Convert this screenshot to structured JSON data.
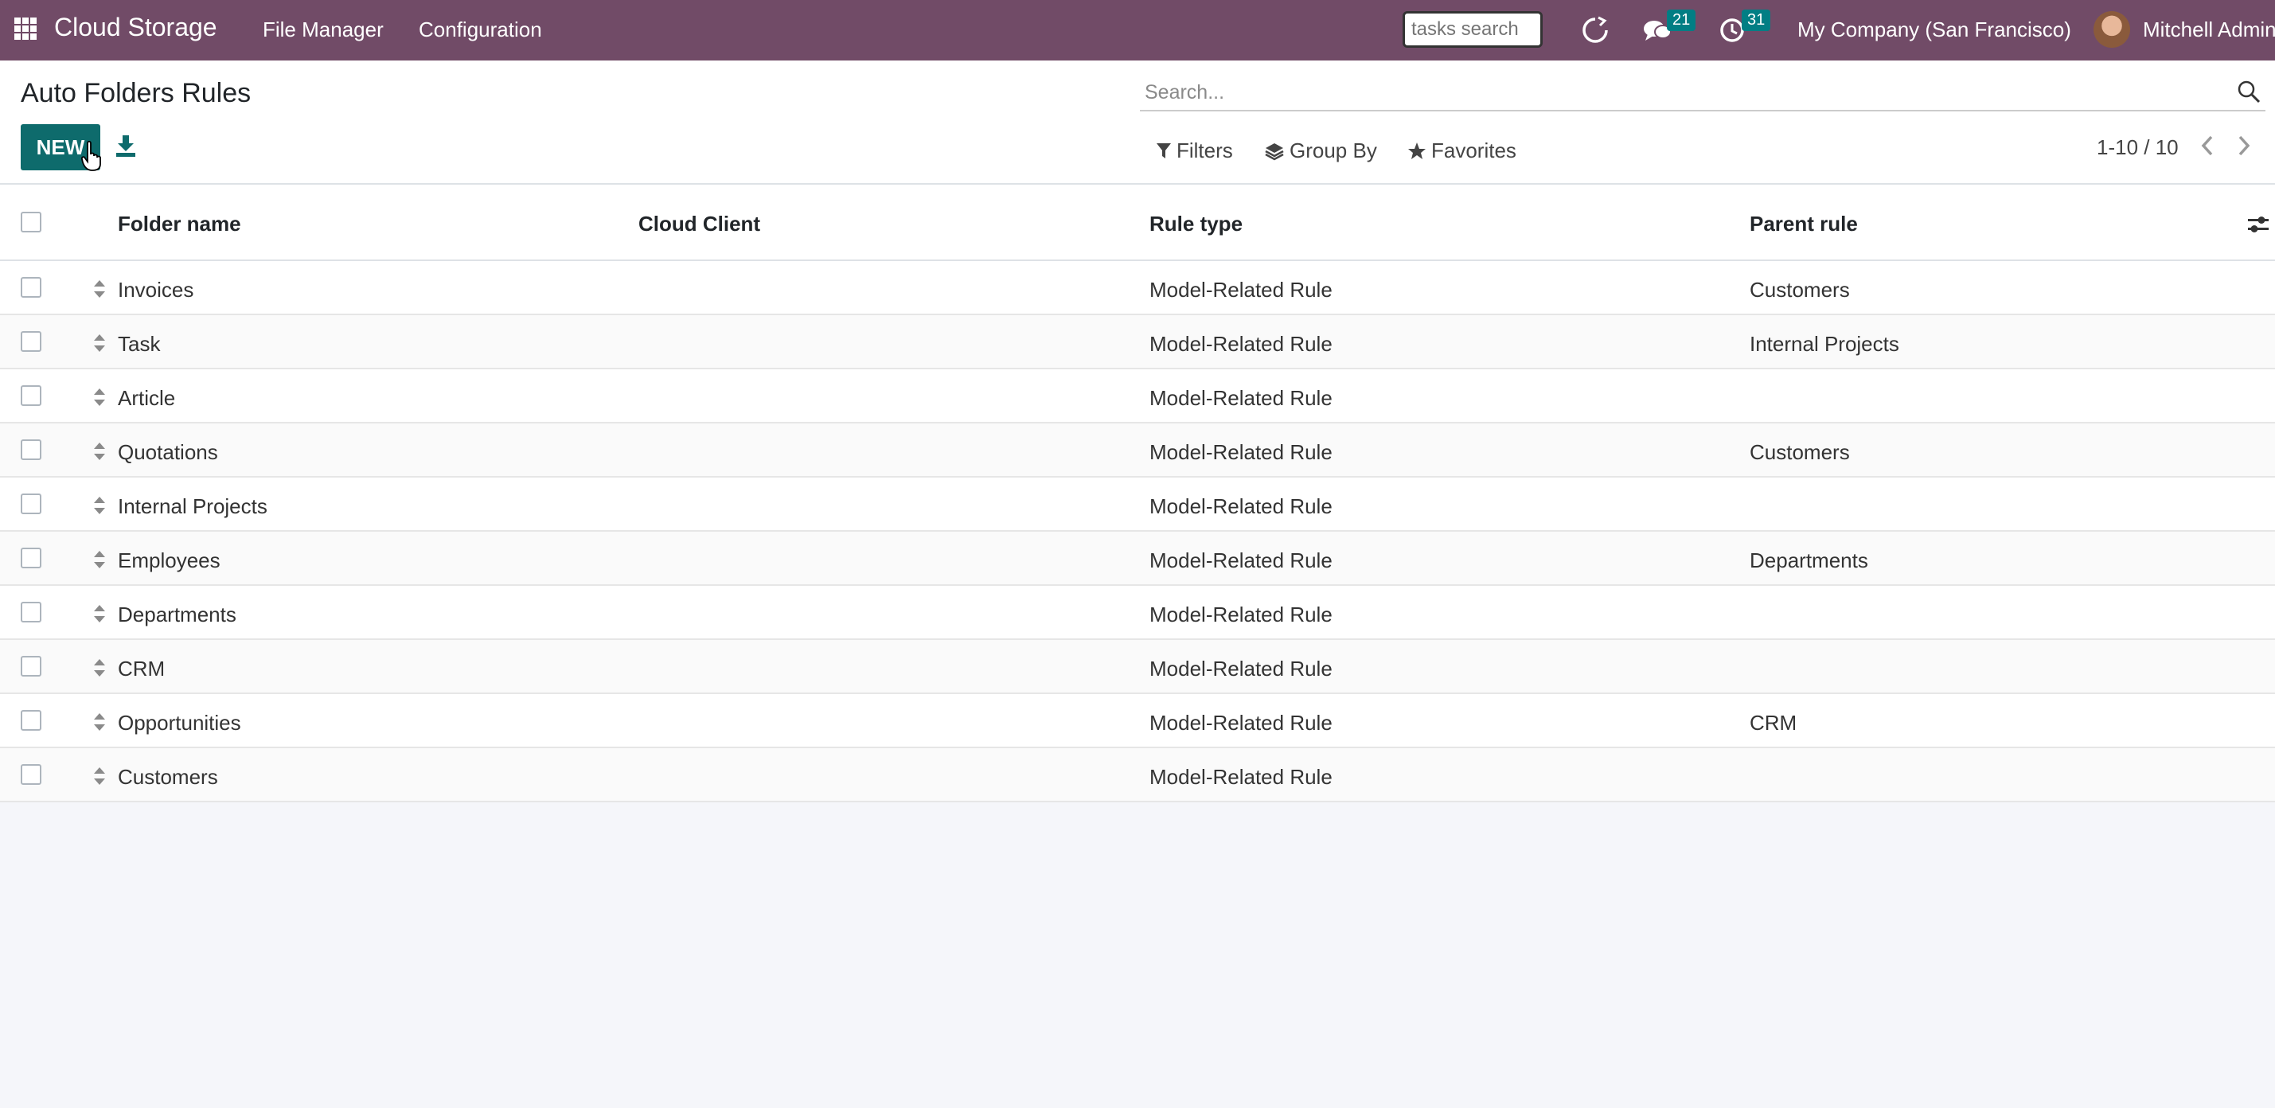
{
  "navbar": {
    "brand": "Cloud Storage",
    "menu": [
      "File Manager",
      "Configuration"
    ],
    "tasks_search_placeholder": "tasks search",
    "messages_count": "21",
    "activities_count": "31",
    "company": "My Company (San Francisco)",
    "user": "Mitchell Admin"
  },
  "control": {
    "title": "Auto Folders Rules",
    "new_label": "NEW",
    "search_placeholder": "Search...",
    "filters_label": "Filters",
    "group_by_label": "Group By",
    "favorites_label": "Favorites",
    "pager": "1-10 / 10"
  },
  "table": {
    "headers": {
      "folder_name": "Folder name",
      "cloud_client": "Cloud Client",
      "rule_type": "Rule type",
      "parent_rule": "Parent rule"
    },
    "rows": [
      {
        "folder": "Invoices",
        "client": "",
        "type": "Model-Related Rule",
        "parent": "Customers"
      },
      {
        "folder": "Task",
        "client": "",
        "type": "Model-Related Rule",
        "parent": "Internal Projects"
      },
      {
        "folder": "Article",
        "client": "",
        "type": "Model-Related Rule",
        "parent": ""
      },
      {
        "folder": "Quotations",
        "client": "",
        "type": "Model-Related Rule",
        "parent": "Customers"
      },
      {
        "folder": "Internal Projects",
        "client": "",
        "type": "Model-Related Rule",
        "parent": ""
      },
      {
        "folder": "Employees",
        "client": "",
        "type": "Model-Related Rule",
        "parent": "Departments"
      },
      {
        "folder": "Departments",
        "client": "",
        "type": "Model-Related Rule",
        "parent": ""
      },
      {
        "folder": "CRM",
        "client": "",
        "type": "Model-Related Rule",
        "parent": ""
      },
      {
        "folder": "Opportunities",
        "client": "",
        "type": "Model-Related Rule",
        "parent": "CRM"
      },
      {
        "folder": "Customers",
        "client": "",
        "type": "Model-Related Rule",
        "parent": ""
      }
    ]
  },
  "colors": {
    "navbar": "#714b67",
    "primary_button": "#0e6b6c",
    "badge": "#017e84"
  }
}
